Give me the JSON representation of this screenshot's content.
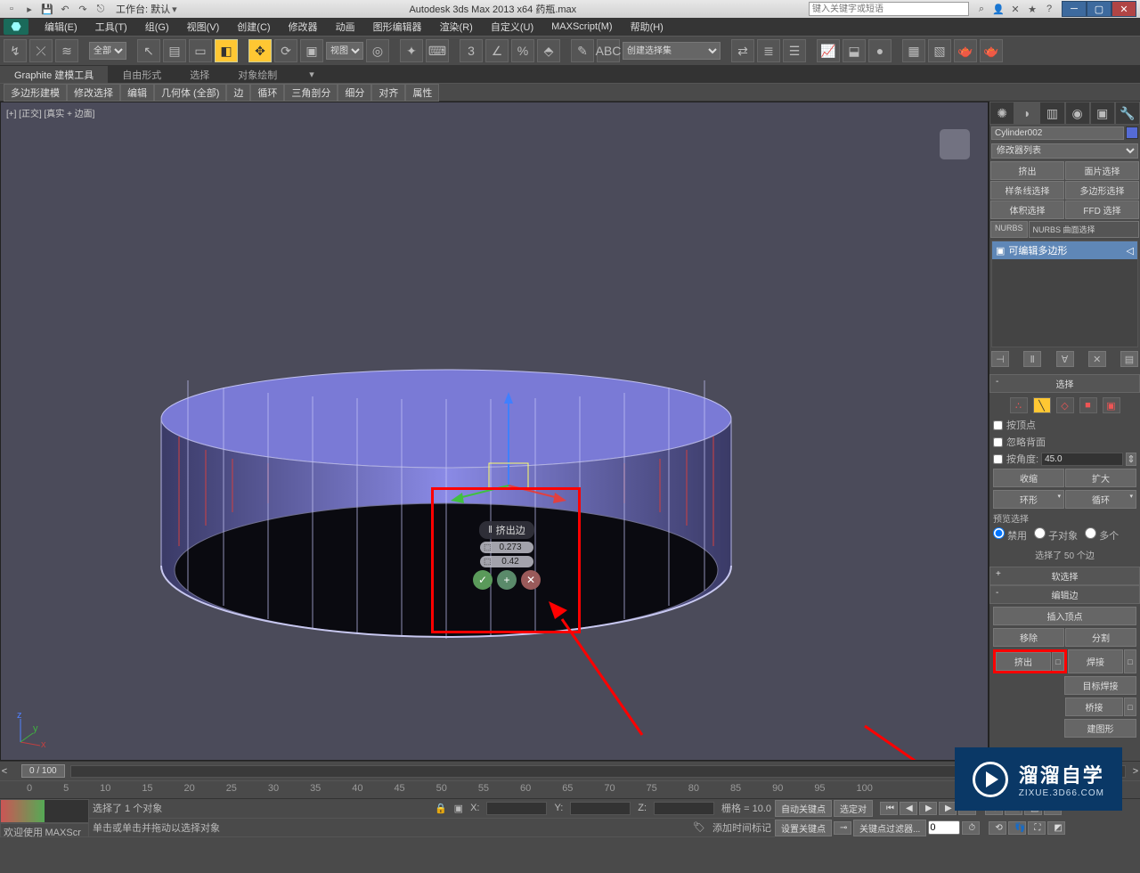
{
  "titlebar": {
    "workspace": "工作台: 默认",
    "title": "Autodesk 3ds Max  2013 x64   药瓶.max",
    "search_placeholder": "键入关键字或短语"
  },
  "menu": [
    "编辑(E)",
    "工具(T)",
    "组(G)",
    "视图(V)",
    "创建(C)",
    "修改器",
    "动画",
    "图形编辑器",
    "渲染(R)",
    "自定义(U)",
    "MAXScript(M)",
    "帮助(H)"
  ],
  "tool_dropdown_all": "全部",
  "tool_dropdown_view": "视图",
  "tool_named_sel": "创建选择集",
  "ribbon_tabs": [
    "Graphite 建模工具",
    "自由形式",
    "选择",
    "对象绘制"
  ],
  "ribbon_row": [
    "多边形建模",
    "修改选择",
    "编辑",
    "几何体 (全部)",
    "边",
    "循环",
    "三角剖分",
    "细分",
    "对齐",
    "属性"
  ],
  "viewport_label": "[+] [正交] [真实 + 边面]",
  "caddy": {
    "title": "挤出边",
    "spin1": "0.273",
    "spin2": "0.42"
  },
  "panel": {
    "obj_name": "Cylinder002",
    "mod_list": "修改器列表",
    "btns": [
      "挤出",
      "面片选择",
      "样条线选择",
      "多边形选择",
      "体积选择",
      "FFD 选择"
    ],
    "nurbs": "NURBS 曲面选择",
    "stack_item": "可编辑多边形",
    "roll_selection": "选择",
    "chk_byvertex": "按顶点",
    "chk_ignoreback": "忽略背面",
    "chk_byangle": "按角度:",
    "angle_val": "45.0",
    "btn_shrink": "收缩",
    "btn_grow": "扩大",
    "btn_ring": "环形",
    "btn_loop": "循环",
    "preview_sel": "预览选择",
    "radio_off": "禁用",
    "radio_subobj": "子对象",
    "radio_multi": "多个",
    "sel_text": "选择了 50 个边",
    "roll_softsel": "软选择",
    "roll_editedge": "编辑边",
    "btn_insertvert": "插入顶点",
    "btn_remove": "移除",
    "btn_split": "分割",
    "btn_extrude": "挤出",
    "btn_weld": "焊接",
    "btn_targetweld": "目标焊接",
    "btn_bridge": "桥接",
    "btn_createshape": "建图形"
  },
  "time": {
    "slider": "0 / 100",
    "ticks": [
      "0",
      "5",
      "10",
      "15",
      "20",
      "25",
      "30",
      "35",
      "40",
      "45",
      "50",
      "55",
      "60",
      "65",
      "70",
      "75",
      "80",
      "85",
      "90",
      "95",
      "100"
    ]
  },
  "status": {
    "selected": "选择了 1 个对象",
    "prompt": "单击或单击并拖动以选择对象",
    "x": "X:",
    "y": "Y:",
    "z": "Z:",
    "grid": "栅格 = 10.0",
    "addtimetag": "添加时间标记",
    "autokey": "自动关键点",
    "setkey": "设置关键点",
    "selset": "选定对",
    "keyfilter": "关键点过滤器...",
    "script1": "欢迎使用",
    "script2": "MAXScr"
  },
  "watermark": {
    "big": "溜溜自学",
    "sm": "ZIXUE.3D66.COM"
  }
}
